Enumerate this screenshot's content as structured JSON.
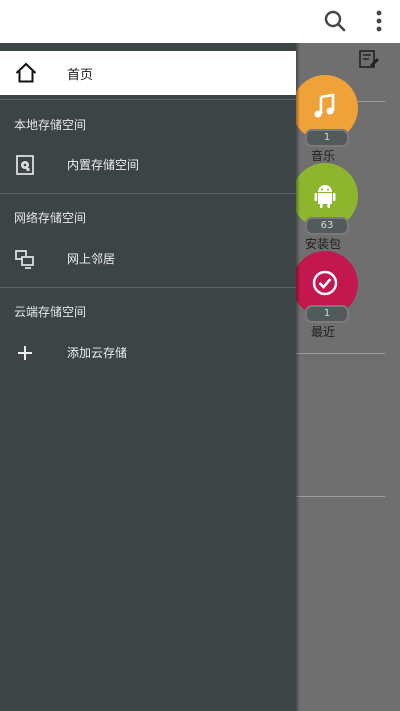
{
  "topbar": {
    "search_icon": "search-icon",
    "more_icon": "more-vertical-icon"
  },
  "drawer": {
    "home": {
      "label": "首页",
      "icon": "home-icon"
    },
    "sections": [
      {
        "title": "本地存储空间",
        "items": [
          {
            "label": "内置存储空间",
            "icon": "internal-storage-icon"
          }
        ]
      },
      {
        "title": "网络存储空间",
        "items": [
          {
            "label": "网上邻居",
            "icon": "network-neighborhood-icon"
          }
        ]
      },
      {
        "title": "云端存储空间",
        "items": [
          {
            "label": "添加云存储",
            "icon": "plus-icon"
          }
        ]
      }
    ]
  },
  "categories": [
    {
      "name": "音乐",
      "count": "1",
      "color": "#f0a23a",
      "icon": "music-note-icon"
    },
    {
      "name": "安装包",
      "count": "63",
      "color": "#8db52e",
      "icon": "android-icon"
    },
    {
      "name": "最近",
      "count": "1",
      "color": "#c3174f",
      "icon": "recent-check-icon"
    }
  ],
  "colors": {
    "drawer_bg": "#3d4445",
    "overlay_bg": "#6f6f6f",
    "topbar_bg": "#ffffff"
  }
}
